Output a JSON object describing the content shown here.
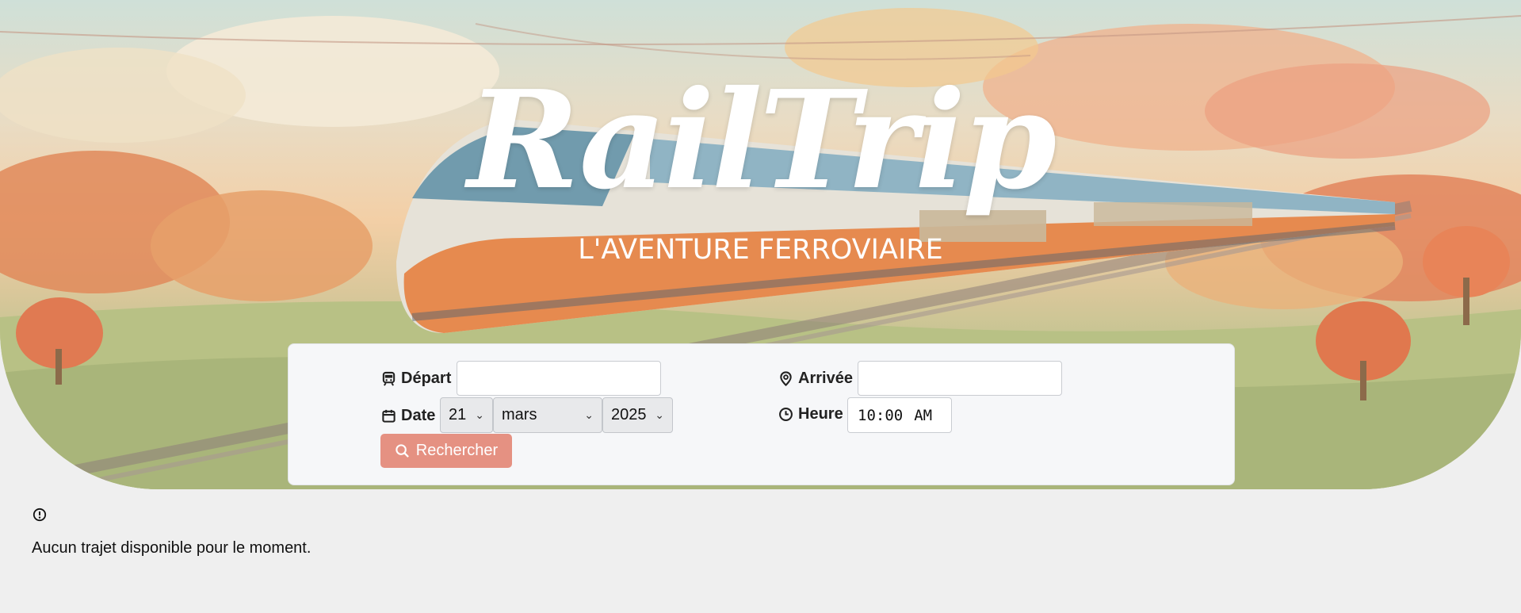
{
  "brand": {
    "title": "RailTrip",
    "subtitle": "L'AVENTURE FERROVIAIRE"
  },
  "search": {
    "depart_label": "Départ",
    "depart_value": "",
    "arrivee_label": "Arrivée",
    "arrivee_value": "",
    "date_label": "Date",
    "date_day": "21",
    "date_month": "mars",
    "date_year": "2025",
    "heure_label": "Heure",
    "time_hour": "10",
    "time_sep": ":",
    "time_minute": "00",
    "time_period": "AM",
    "button_label": "Rechercher"
  },
  "results": {
    "empty_message": "Aucun trajet disponible pour le moment."
  },
  "colors": {
    "accent": "#e59182",
    "panel": "#f6f7f9",
    "page_bg": "#efefef"
  },
  "icons": {
    "depart": "train-icon",
    "date": "calendar-icon",
    "arrivee": "map-pin-icon",
    "heure": "clock-icon",
    "button": "search-icon",
    "results": "alert-circle-icon"
  }
}
